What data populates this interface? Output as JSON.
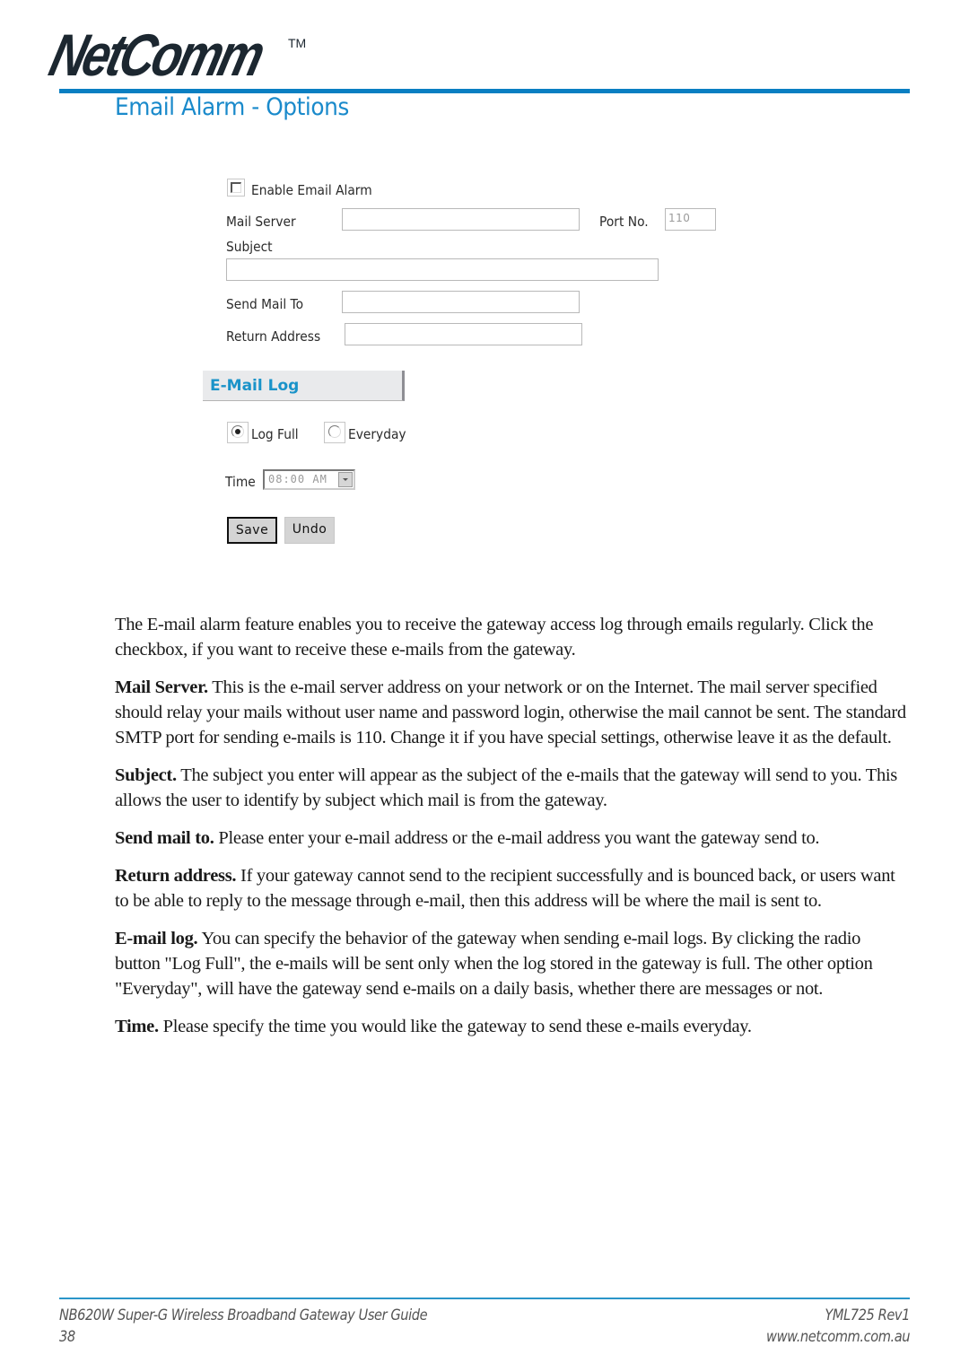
{
  "header": {
    "logo_text": "NetComm",
    "logo_tm": "TM",
    "page_title": "Email Alarm - Options",
    "accent_color": "#0a7fc2"
  },
  "form": {
    "enable_checkbox": {
      "label": "Enable Email Alarm",
      "checked": false
    },
    "mail_server": {
      "label": "Mail Server",
      "value": ""
    },
    "port": {
      "label": "Port No.",
      "value": "110"
    },
    "subject": {
      "label": "Subject",
      "value": ""
    },
    "send_mail_to": {
      "label": "Send Mail To",
      "value": ""
    },
    "return_address": {
      "label": "Return Address",
      "value": ""
    },
    "email_log_section": {
      "title": "E-Mail Log"
    },
    "log_options": [
      {
        "label": "Log Full",
        "selected": true
      },
      {
        "label": "Everyday",
        "selected": false
      }
    ],
    "time": {
      "label": "Time",
      "value": "08:00 AM"
    },
    "buttons": {
      "save": "Save",
      "undo": "Undo"
    }
  },
  "description": {
    "intro": "The E-mail alarm feature enables you to receive the gateway access log through emails regularly. Click the checkbox, if you want to receive these e-mails from the gateway.",
    "items": [
      {
        "term": "Mail Server.",
        "text": " This is the e-mail server address on your network or on the Internet. The mail server specified should relay your mails without user name and password login, otherwise the mail cannot be sent. The standard SMTP port for sending e-mails is 110. Change it if you have special settings, otherwise leave it as the default."
      },
      {
        "term": "Subject.",
        "text": " The subject you enter will appear as the subject of the e-mails that the gateway will send to you. This allows the user to identify by subject which mail is from the gateway."
      },
      {
        "term": "Send mail to.",
        "text": " Please enter your e-mail address or the e-mail address you want the gateway send to."
      },
      {
        "term": "Return address.",
        "text": " If your gateway cannot send to the recipient successfully and is bounced back, or users want to be able to reply to the message through e-mail, then this address will be where the mail is sent to."
      },
      {
        "term": "E-mail log.",
        "text": " You can specify the behavior of the gateway when sending e-mail logs. By clicking the radio button \"Log Full\", the e-mails will be sent only when the log stored in the gateway is full. The other option \"Everyday\", will have the gateway send e-mails on a daily basis, whether there are messages or not."
      },
      {
        "term": "Time.",
        "text": " Please specify the time you would like the gateway to send these e-mails everyday."
      }
    ]
  },
  "footer": {
    "guide_title": "NB620W Super-G Wireless Broadband  Gateway User Guide",
    "page_number": "38",
    "doc_code": "YML725 Rev1",
    "website": "www.netcomm.com.au"
  }
}
